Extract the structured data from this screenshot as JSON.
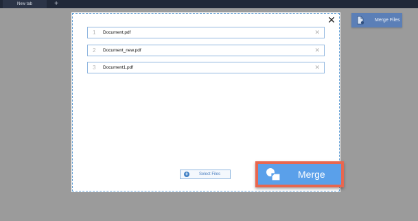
{
  "browser": {
    "tab_title": "New tab",
    "new_tab_symbol": "+"
  },
  "sidebar": {
    "merge_files_label": "Merge Files",
    "icon": "document-merge-icon"
  },
  "dialog": {
    "close_symbol": "✕",
    "files": [
      {
        "index": "1",
        "name": "Document.pdf"
      },
      {
        "index": "2",
        "name": "Document_new.pdf"
      },
      {
        "index": "3",
        "name": "Document1.pdf"
      }
    ],
    "remove_symbol": "✕",
    "select_files_label": "Select Files",
    "merge_label": "Merge"
  },
  "colors": {
    "background": "#9b9b9b",
    "tabbar": "#202838",
    "accent_blue": "#5aa0ea",
    "highlight_outline": "#e8674f",
    "dialog_dash": "#5d9bd3"
  }
}
